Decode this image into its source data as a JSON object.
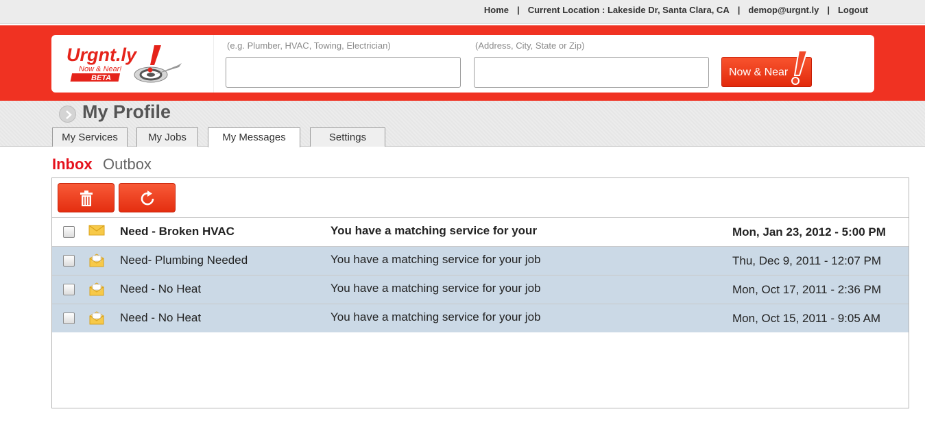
{
  "topnav": {
    "home": "Home",
    "location": "Current Location : Lakeside Dr, Santa Clara, CA",
    "email": "demop@urgnt.ly",
    "logout": "Logout",
    "separator": "|"
  },
  "logo": {
    "name": "Urgnt.ly",
    "tagline": "Now & Near!",
    "badge": "BETA"
  },
  "search": {
    "service_hint": "(e.g. Plumber, HVAC, Towing, Electrician)",
    "service_value": "",
    "location_hint": "(Address, City, State or Zip)",
    "location_value": "",
    "button_label": "Now & Near"
  },
  "profile": {
    "title": "My Profile",
    "tabs": [
      {
        "label": "My Services",
        "active": false
      },
      {
        "label": "My Jobs",
        "active": false
      },
      {
        "label": "My Messages",
        "active": true
      },
      {
        "label": "Settings",
        "active": false
      }
    ]
  },
  "mailbox": {
    "inbox_label": "Inbox",
    "outbox_label": "Outbox",
    "toolbar": [
      {
        "icon": "trash-icon"
      },
      {
        "icon": "refresh-icon"
      }
    ],
    "messages": [
      {
        "subject": "Need - Broken HVAC",
        "preview": "You have a matching service for your",
        "date": "Mon, Jan 23, 2012 - 5:00 PM",
        "unread": true
      },
      {
        "subject": "Need- Plumbing Needed",
        "preview": "You have a matching service for your job",
        "date": "Thu, Dec 9, 2011 - 12:07 PM",
        "unread": false
      },
      {
        "subject": "Need - No Heat",
        "preview": "You have a matching service for your job",
        "date": "Mon, Oct 17, 2011 - 2:36 PM",
        "unread": false
      },
      {
        "subject": "Need - No Heat",
        "preview": "You have a matching service for your job",
        "date": "Mon, Oct 15, 2011 - 9:05 AM",
        "unread": false
      }
    ]
  },
  "colors": {
    "brand_red": "#f03222",
    "inbox_red": "#e5121d",
    "read_row": "#cbd9e6"
  }
}
